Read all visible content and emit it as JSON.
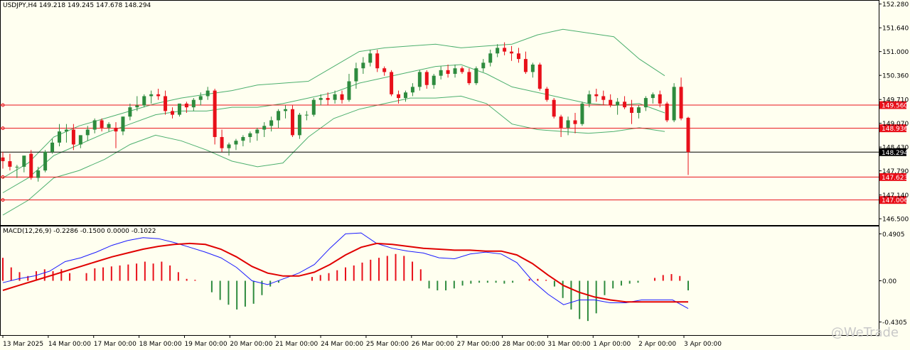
{
  "header": {
    "symbol_line": "USDJPY,H4  149.218 149.245 147.678 148.294",
    "macd_line": "MACD(12,26,9) -0.2286 -0.1500 0.0000 -0.1022"
  },
  "watermark": "@WeTrade",
  "colors": {
    "background": "#fffff0",
    "bull": "#2e8b3e",
    "bear": "#e8101a",
    "band": "#4caf6e",
    "hline": "#e8101a",
    "current": "#000000",
    "macd_main": "#1a1aff",
    "macd_signal": "#e00000"
  },
  "chart_data": [
    {
      "type": "candlestick",
      "title": "USDJPY,H4",
      "ohlc_header": {
        "open": 149.218,
        "high": 149.245,
        "low": 147.678,
        "close": 148.294
      },
      "ylim": [
        146.35,
        152.35
      ],
      "y_ticks": [
        "152.280",
        "151.640",
        "151.000",
        "150.360",
        "149.710",
        "149.070",
        "148.430",
        "147.790",
        "147.140",
        "146.500"
      ],
      "x_ticks": [
        "13 Mar 2025",
        "14 Mar 00:00",
        "17 Mar 00:00",
        "18 Mar 00:00",
        "19 Mar 00:00",
        "20 Mar 00:00",
        "21 Mar 00:00",
        "24 Mar 00:00",
        "25 Mar 00:00",
        "26 Mar 00:00",
        "27 Mar 00:00",
        "28 Mar 00:00",
        "31 Mar 00:00",
        "1 Apr 00:00",
        "2 Apr 00:00",
        "3 Apr 00:00"
      ],
      "horizontal_lines": [
        {
          "value": 149.56,
          "label": "149.560"
        },
        {
          "value": 148.936,
          "label": "148.936"
        },
        {
          "value": 147.623,
          "label": "147.623"
        },
        {
          "value": 147.006,
          "label": "147.006"
        }
      ],
      "current_price": {
        "value": 148.294,
        "label": "148.294"
      },
      "candles": [
        {
          "o": 148.15,
          "h": 148.3,
          "l": 147.85,
          "c": 148.05
        },
        {
          "o": 148.05,
          "h": 148.25,
          "l": 147.8,
          "c": 147.9
        },
        {
          "o": 147.9,
          "h": 147.95,
          "l": 147.6,
          "c": 147.9
        },
        {
          "o": 147.9,
          "h": 148.15,
          "l": 147.75,
          "c": 148.2
        },
        {
          "o": 148.25,
          "h": 148.35,
          "l": 147.55,
          "c": 147.6
        },
        {
          "o": 147.6,
          "h": 147.9,
          "l": 147.5,
          "c": 147.8
        },
        {
          "o": 147.8,
          "h": 148.35,
          "l": 147.75,
          "c": 148.3
        },
        {
          "o": 148.3,
          "h": 148.65,
          "l": 148.25,
          "c": 148.55
        },
        {
          "o": 148.55,
          "h": 149.05,
          "l": 148.45,
          "c": 148.85
        },
        {
          "o": 148.85,
          "h": 149.05,
          "l": 148.55,
          "c": 148.9
        },
        {
          "o": 148.9,
          "h": 149.05,
          "l": 148.35,
          "c": 148.5
        },
        {
          "o": 148.5,
          "h": 148.75,
          "l": 148.4,
          "c": 148.75
        },
        {
          "o": 148.75,
          "h": 149.0,
          "l": 148.6,
          "c": 148.9
        },
        {
          "o": 148.9,
          "h": 149.2,
          "l": 148.8,
          "c": 149.15
        },
        {
          "o": 149.15,
          "h": 149.2,
          "l": 148.85,
          "c": 148.95
        },
        {
          "o": 148.95,
          "h": 149.1,
          "l": 148.85,
          "c": 149.05
        },
        {
          "o": 148.95,
          "h": 149.1,
          "l": 148.4,
          "c": 148.85
        },
        {
          "o": 148.85,
          "h": 149.25,
          "l": 148.75,
          "c": 149.25
        },
        {
          "o": 149.25,
          "h": 149.6,
          "l": 149.15,
          "c": 149.5
        },
        {
          "o": 149.5,
          "h": 149.8,
          "l": 149.4,
          "c": 149.55
        },
        {
          "o": 149.55,
          "h": 149.85,
          "l": 149.5,
          "c": 149.8
        },
        {
          "o": 149.8,
          "h": 149.95,
          "l": 149.6,
          "c": 149.85
        },
        {
          "o": 149.85,
          "h": 150.0,
          "l": 149.7,
          "c": 149.8
        },
        {
          "o": 149.8,
          "h": 149.95,
          "l": 149.3,
          "c": 149.4
        },
        {
          "o": 149.4,
          "h": 149.5,
          "l": 149.2,
          "c": 149.3
        },
        {
          "o": 149.3,
          "h": 149.6,
          "l": 149.25,
          "c": 149.6
        },
        {
          "o": 149.6,
          "h": 149.65,
          "l": 149.35,
          "c": 149.5
        },
        {
          "o": 149.5,
          "h": 149.75,
          "l": 149.4,
          "c": 149.7
        },
        {
          "o": 149.7,
          "h": 149.9,
          "l": 149.55,
          "c": 149.8
        },
        {
          "o": 149.8,
          "h": 150.05,
          "l": 149.7,
          "c": 149.95
        },
        {
          "o": 149.95,
          "h": 150.0,
          "l": 148.5,
          "c": 148.7
        },
        {
          "o": 148.7,
          "h": 148.9,
          "l": 148.3,
          "c": 148.4
        },
        {
          "o": 148.4,
          "h": 148.55,
          "l": 148.2,
          "c": 148.5
        },
        {
          "o": 148.5,
          "h": 148.65,
          "l": 148.35,
          "c": 148.6
        },
        {
          "o": 148.6,
          "h": 148.75,
          "l": 148.45,
          "c": 148.7
        },
        {
          "o": 148.7,
          "h": 148.85,
          "l": 148.55,
          "c": 148.8
        },
        {
          "o": 148.8,
          "h": 148.95,
          "l": 148.6,
          "c": 148.9
        },
        {
          "o": 148.9,
          "h": 149.1,
          "l": 148.7,
          "c": 149.0
        },
        {
          "o": 149.0,
          "h": 149.25,
          "l": 148.85,
          "c": 149.15
        },
        {
          "o": 149.15,
          "h": 149.45,
          "l": 148.95,
          "c": 149.4
        },
        {
          "o": 149.4,
          "h": 149.55,
          "l": 149.2,
          "c": 149.45
        },
        {
          "o": 149.45,
          "h": 149.55,
          "l": 148.7,
          "c": 148.75
        },
        {
          "o": 148.75,
          "h": 149.35,
          "l": 148.65,
          "c": 149.3
        },
        {
          "o": 149.3,
          "h": 149.4,
          "l": 149.15,
          "c": 149.3
        },
        {
          "o": 149.3,
          "h": 149.75,
          "l": 149.25,
          "c": 149.7
        },
        {
          "o": 149.7,
          "h": 149.85,
          "l": 149.55,
          "c": 149.75
        },
        {
          "o": 149.75,
          "h": 149.9,
          "l": 149.55,
          "c": 149.7
        },
        {
          "o": 149.7,
          "h": 149.95,
          "l": 149.6,
          "c": 149.85
        },
        {
          "o": 149.85,
          "h": 149.95,
          "l": 149.6,
          "c": 149.7
        },
        {
          "o": 149.7,
          "h": 150.4,
          "l": 149.65,
          "c": 150.2
        },
        {
          "o": 150.2,
          "h": 150.7,
          "l": 150.0,
          "c": 150.55
        },
        {
          "o": 150.55,
          "h": 150.85,
          "l": 150.4,
          "c": 150.7
        },
        {
          "o": 150.7,
          "h": 151.05,
          "l": 150.6,
          "c": 150.95
        },
        {
          "o": 150.95,
          "h": 151.05,
          "l": 150.45,
          "c": 150.55
        },
        {
          "o": 150.55,
          "h": 150.6,
          "l": 150.35,
          "c": 150.45
        },
        {
          "o": 150.45,
          "h": 150.5,
          "l": 149.8,
          "c": 149.85
        },
        {
          "o": 149.85,
          "h": 149.95,
          "l": 149.6,
          "c": 149.75
        },
        {
          "o": 149.75,
          "h": 149.95,
          "l": 149.65,
          "c": 149.9
        },
        {
          "o": 149.9,
          "h": 150.15,
          "l": 149.8,
          "c": 150.05
        },
        {
          "o": 150.05,
          "h": 150.5,
          "l": 149.95,
          "c": 150.45
        },
        {
          "o": 150.45,
          "h": 150.5,
          "l": 150.0,
          "c": 150.1
        },
        {
          "o": 150.1,
          "h": 150.4,
          "l": 150.0,
          "c": 150.35
        },
        {
          "o": 150.35,
          "h": 150.6,
          "l": 150.25,
          "c": 150.5
        },
        {
          "o": 150.5,
          "h": 150.65,
          "l": 150.3,
          "c": 150.4
        },
        {
          "o": 150.4,
          "h": 150.65,
          "l": 150.3,
          "c": 150.55
        },
        {
          "o": 150.55,
          "h": 150.6,
          "l": 150.4,
          "c": 150.45
        },
        {
          "o": 150.45,
          "h": 150.55,
          "l": 150.1,
          "c": 150.15
        },
        {
          "o": 150.15,
          "h": 150.6,
          "l": 150.1,
          "c": 150.55
        },
        {
          "o": 150.55,
          "h": 150.8,
          "l": 150.45,
          "c": 150.7
        },
        {
          "o": 150.7,
          "h": 151.05,
          "l": 150.6,
          "c": 150.95
        },
        {
          "o": 150.95,
          "h": 151.2,
          "l": 150.85,
          "c": 151.1
        },
        {
          "o": 151.1,
          "h": 151.25,
          "l": 150.9,
          "c": 151.0
        },
        {
          "o": 151.0,
          "h": 151.15,
          "l": 150.75,
          "c": 150.95
        },
        {
          "o": 150.95,
          "h": 151.1,
          "l": 150.7,
          "c": 150.8
        },
        {
          "o": 150.8,
          "h": 151.0,
          "l": 150.4,
          "c": 150.45
        },
        {
          "o": 150.45,
          "h": 150.7,
          "l": 150.3,
          "c": 150.65
        },
        {
          "o": 150.65,
          "h": 150.7,
          "l": 149.95,
          "c": 150.0
        },
        {
          "o": 150.0,
          "h": 150.05,
          "l": 149.65,
          "c": 149.7
        },
        {
          "o": 149.7,
          "h": 149.75,
          "l": 149.2,
          "c": 149.25
        },
        {
          "o": 149.25,
          "h": 149.3,
          "l": 148.7,
          "c": 148.95
        },
        {
          "o": 148.95,
          "h": 149.25,
          "l": 148.75,
          "c": 149.15
        },
        {
          "o": 149.15,
          "h": 149.35,
          "l": 148.8,
          "c": 149.05
        },
        {
          "o": 149.05,
          "h": 149.65,
          "l": 149.0,
          "c": 149.6
        },
        {
          "o": 149.6,
          "h": 149.95,
          "l": 149.5,
          "c": 149.85
        },
        {
          "o": 149.85,
          "h": 150.0,
          "l": 149.65,
          "c": 149.8
        },
        {
          "o": 149.8,
          "h": 149.95,
          "l": 149.55,
          "c": 149.7
        },
        {
          "o": 149.7,
          "h": 149.85,
          "l": 149.5,
          "c": 149.55
        },
        {
          "o": 149.55,
          "h": 149.75,
          "l": 149.3,
          "c": 149.65
        },
        {
          "o": 149.65,
          "h": 149.8,
          "l": 149.45,
          "c": 149.5
        },
        {
          "o": 149.5,
          "h": 149.7,
          "l": 149.05,
          "c": 149.35
        },
        {
          "o": 149.35,
          "h": 149.55,
          "l": 149.2,
          "c": 149.5
        },
        {
          "o": 149.5,
          "h": 149.8,
          "l": 149.4,
          "c": 149.75
        },
        {
          "o": 149.75,
          "h": 149.9,
          "l": 149.6,
          "c": 149.85
        },
        {
          "o": 149.85,
          "h": 149.95,
          "l": 149.5,
          "c": 149.6
        },
        {
          "o": 149.6,
          "h": 149.65,
          "l": 149.1,
          "c": 149.15
        },
        {
          "o": 149.15,
          "h": 150.15,
          "l": 149.1,
          "c": 150.05
        },
        {
          "o": 150.05,
          "h": 150.3,
          "l": 149.15,
          "c": 149.2
        },
        {
          "o": 149.218,
          "h": 149.245,
          "l": 147.678,
          "c": 148.294
        }
      ],
      "bollinger": {
        "upper": [
          147.6,
          148.0,
          148.7,
          149.0,
          149.2,
          149.4,
          149.6,
          149.75,
          149.85,
          149.95,
          150.1,
          150.15,
          150.2,
          150.6,
          151.0,
          151.1,
          151.15,
          151.2,
          151.1,
          151.15,
          151.2,
          151.45,
          151.6,
          151.5,
          151.4,
          150.8,
          150.35
        ],
        "middle": [
          147.2,
          147.6,
          148.2,
          148.5,
          148.8,
          149.05,
          149.3,
          149.4,
          149.4,
          149.5,
          149.5,
          149.6,
          149.75,
          149.9,
          150.15,
          150.3,
          150.45,
          150.6,
          150.65,
          150.4,
          150.05,
          149.9,
          149.75,
          149.6,
          149.55,
          149.6,
          149.35
        ],
        "lower": [
          146.6,
          147.0,
          147.6,
          147.8,
          148.1,
          148.5,
          148.75,
          148.6,
          148.35,
          148.05,
          147.9,
          148.0,
          148.7,
          149.2,
          149.45,
          149.6,
          149.75,
          149.75,
          149.8,
          149.6,
          149.05,
          148.9,
          148.85,
          148.8,
          148.85,
          148.95,
          148.85
        ]
      }
    },
    {
      "type": "macd",
      "title": "MACD(12,26,9)",
      "values": {
        "main": -0.2286,
        "signal": -0.15,
        "histogram": 0.0,
        "last": -0.1022
      },
      "ylim": [
        -0.56,
        0.56
      ],
      "y_ticks": [
        "0.4905",
        "0.00",
        "-0.4305"
      ],
      "main_line": [
        -0.02,
        0.02,
        0.05,
        0.1,
        0.2,
        0.24,
        0.3,
        0.37,
        0.42,
        0.45,
        0.44,
        0.4,
        0.35,
        0.3,
        0.24,
        0.14,
        0.0,
        -0.04,
        0.02,
        0.08,
        0.17,
        0.34,
        0.49,
        0.5,
        0.39,
        0.34,
        0.31,
        0.29,
        0.24,
        0.23,
        0.28,
        0.3,
        0.28,
        0.19,
        0.0,
        -0.14,
        -0.25,
        -0.2,
        -0.2,
        -0.23,
        -0.23,
        -0.2,
        -0.2,
        -0.2,
        -0.29
      ],
      "signal_line": [
        -0.1,
        -0.05,
        0.0,
        0.05,
        0.1,
        0.15,
        0.2,
        0.25,
        0.29,
        0.33,
        0.36,
        0.38,
        0.39,
        0.38,
        0.33,
        0.25,
        0.15,
        0.08,
        0.05,
        0.05,
        0.09,
        0.17,
        0.27,
        0.35,
        0.39,
        0.38,
        0.36,
        0.34,
        0.33,
        0.32,
        0.32,
        0.31,
        0.31,
        0.27,
        0.18,
        0.06,
        -0.05,
        -0.12,
        -0.17,
        -0.2,
        -0.22,
        -0.22,
        -0.22,
        -0.22,
        -0.22
      ],
      "histogram": [
        0.24,
        0.14,
        0.09,
        0.05,
        0.1,
        0.12,
        0.1,
        0.12,
        0.08,
        0.0,
        0.08,
        0.13,
        0.14,
        0.15,
        0.16,
        0.17,
        0.18,
        0.2,
        0.18,
        0.2,
        0.16,
        0.09,
        0.02,
        0.01,
        0.0,
        -0.12,
        -0.2,
        -0.25,
        -0.3,
        -0.27,
        -0.24,
        -0.15,
        -0.06,
        -0.02,
        0.0,
        0.0,
        0.0,
        0.04,
        0.06,
        0.08,
        0.11,
        0.14,
        0.16,
        0.19,
        0.22,
        0.24,
        0.26,
        0.28,
        0.26,
        0.2,
        0.12,
        -0.08,
        -0.1,
        -0.1,
        -0.08,
        -0.05,
        -0.03,
        -0.02,
        -0.02,
        -0.02,
        -0.03,
        -0.02,
        0.0,
        0.02,
        0.02,
        0.01,
        -0.06,
        -0.18,
        -0.3,
        -0.4,
        -0.42,
        -0.34,
        -0.15,
        -0.08,
        -0.05,
        -0.03,
        -0.02,
        0.0,
        0.03,
        0.06,
        0.07,
        0.05,
        -0.1
      ]
    }
  ]
}
